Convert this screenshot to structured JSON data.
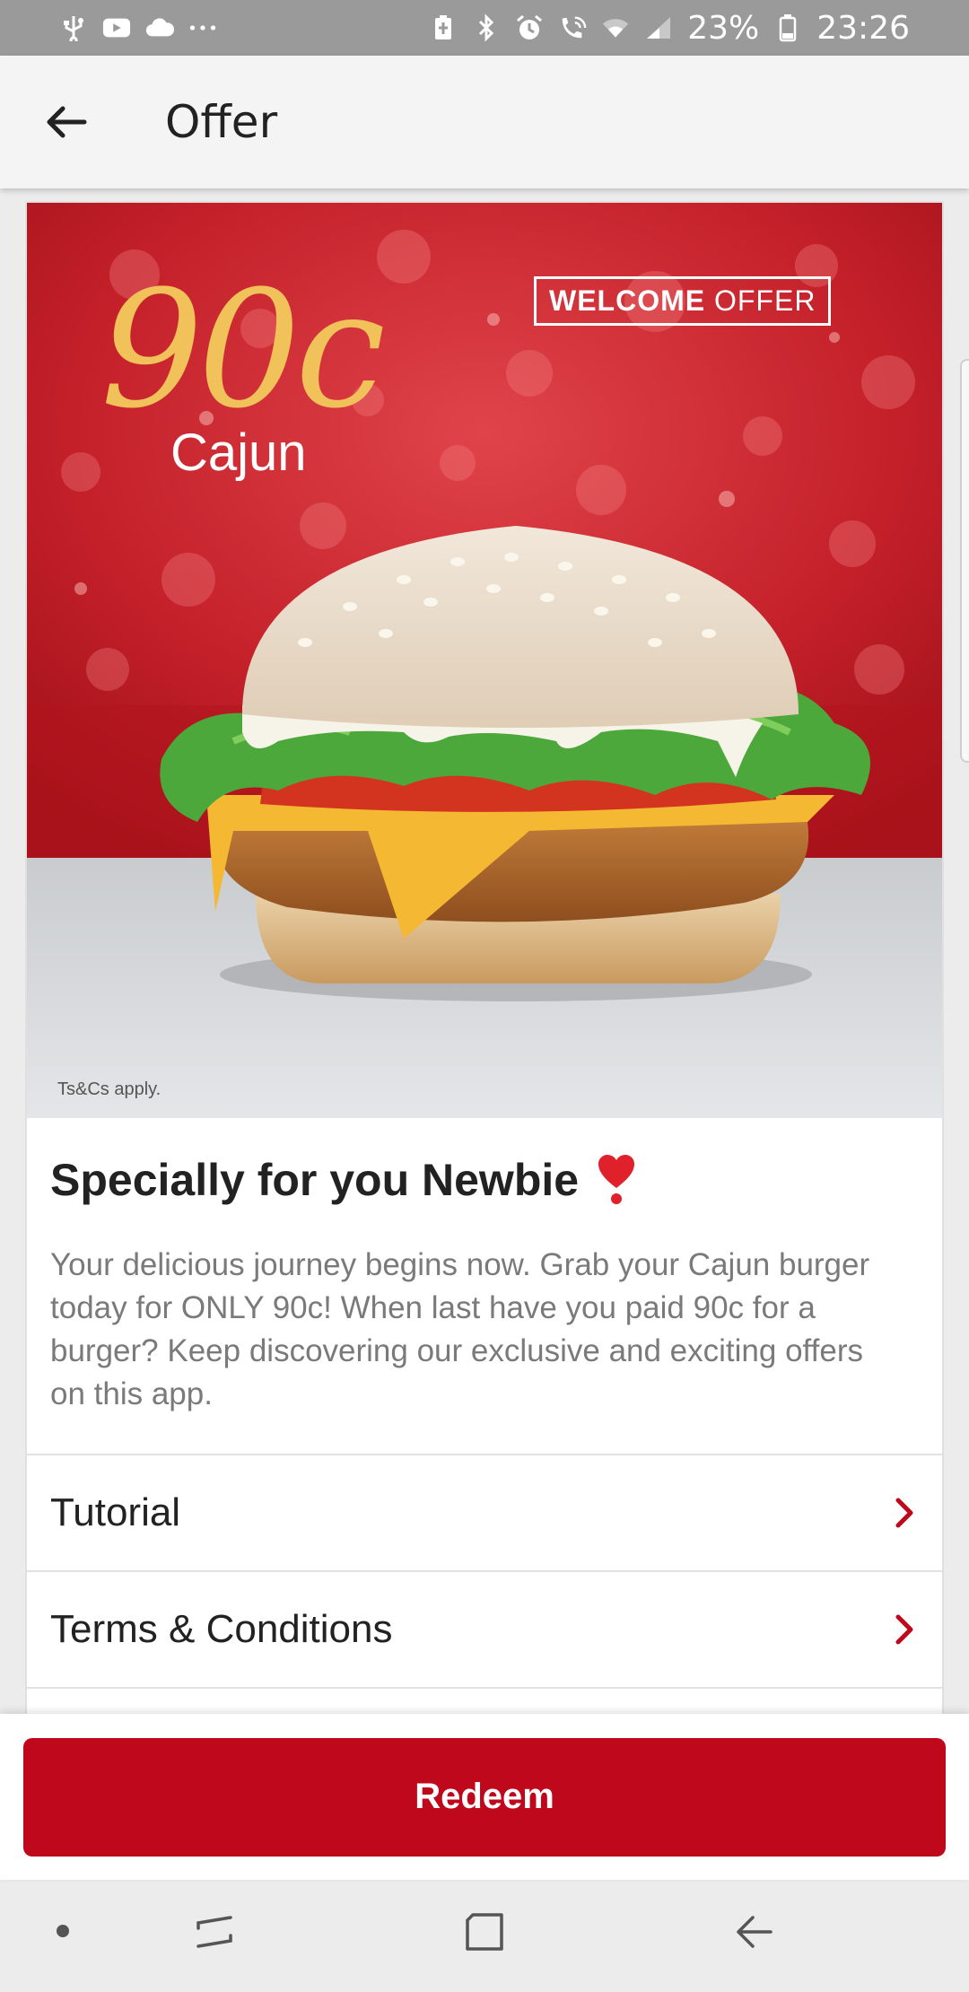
{
  "status_bar": {
    "battery": "23%",
    "time": "23:26"
  },
  "app_bar": {
    "title": "Offer"
  },
  "hero": {
    "price": "90c",
    "product": "Cajun",
    "badge_bold": "WELCOME",
    "badge_rest": " OFFER",
    "fine_print": "Ts&Cs apply."
  },
  "offer": {
    "title": "Specially for you Newbie",
    "description": "Your delicious journey begins now. Grab your Cajun burger today for ONLY 90c! When last have you paid 90c for a burger? Keep discovering our exclusive and exciting offers on this app."
  },
  "links": [
    {
      "label": "Tutorial"
    },
    {
      "label": "Terms & Conditions"
    }
  ],
  "actions": {
    "redeem_label": "Redeem"
  },
  "colors": {
    "accent": "#c0081c",
    "hero_red": "#c4202a",
    "price_gold": "#f1c15a"
  }
}
